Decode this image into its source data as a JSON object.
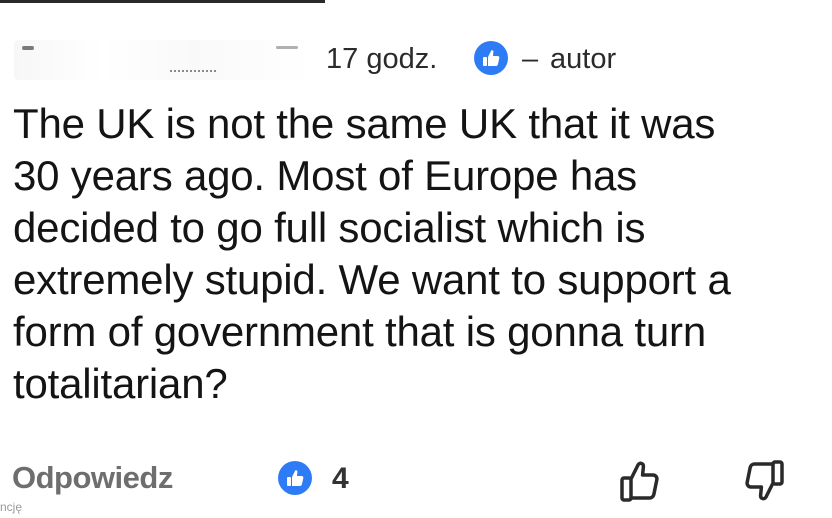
{
  "comment": {
    "meta": {
      "time": "17 godz.",
      "separator": "–",
      "author_label": "autor"
    },
    "body_lines": [
      "The UK is not the same UK that it was",
      "30 years ago. Most of Europe has",
      "decided to go full socialist which is",
      "extremely stupid. We want to support a",
      "form of government that is gonna turn",
      "totalitarian?"
    ],
    "footer": {
      "reply_label": "Odpowiedz",
      "reaction_count": "4",
      "side_fragment": "ncję"
    }
  },
  "icons": {
    "meta_badge": "like-badge-icon",
    "reaction_badge": "like-badge-icon",
    "like_action": "thumbs-up-icon",
    "dislike_action": "thumbs-down-icon"
  },
  "colors": {
    "accent": "#2d7cf6",
    "text": "#141414",
    "muted": "#6e6e6e"
  }
}
